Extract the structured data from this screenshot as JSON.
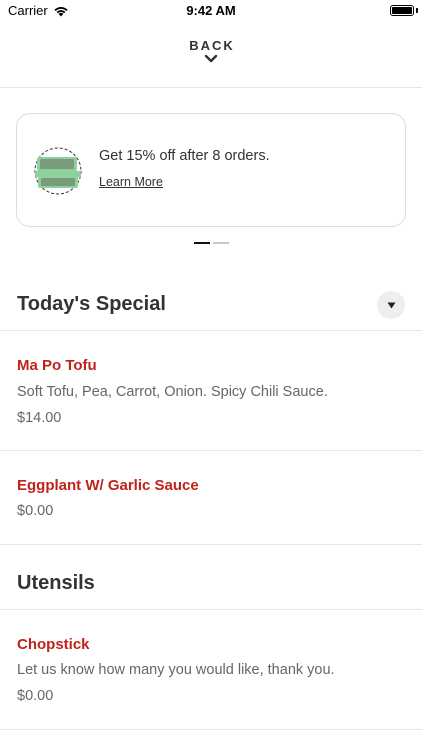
{
  "status_bar": {
    "carrier": "Carrier",
    "time": "9:42 AM",
    "icons": [
      "wifi-icon",
      "battery-icon"
    ]
  },
  "header": {
    "back_label": "BACK",
    "back_icon": "chevron-down-icon"
  },
  "promo": {
    "text": "Get 15% off after 8 orders.",
    "link": "Learn More",
    "icon": "takeout-box-icon",
    "icon_color": "#8fd19e",
    "pages": 2,
    "active_page": 1
  },
  "sections": [
    {
      "title": "Today's Special",
      "collapse_icon": "caret-down-icon",
      "items": [
        {
          "name": "Ma Po Tofu",
          "description": "Soft Tofu, Pea, Carrot, Onion. Spicy Chili Sauce.",
          "price": "$14.00"
        },
        {
          "name": "Eggplant W/ Garlic Sauce",
          "price": "$0.00"
        }
      ]
    },
    {
      "title": "Utensils",
      "items": [
        {
          "name": "Chopstick",
          "description": "Let us know how many you would like, thank you.",
          "price": "$0.00"
        }
      ]
    }
  ],
  "colors": {
    "item_name": "#c0231a",
    "text": "#333333",
    "muted": "#666666",
    "divider": "#e6e6e6"
  }
}
